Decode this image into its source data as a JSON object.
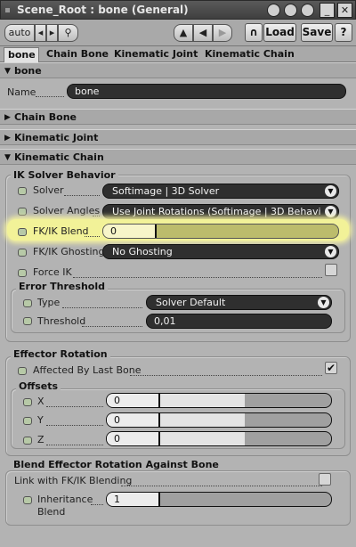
{
  "window": {
    "title": "Scene_Root : bone (General)"
  },
  "toolbar": {
    "auto_label": "auto",
    "prev_label": "◂",
    "next_label": "▸",
    "load_label": "Load",
    "save_label": "Save",
    "help_label": "?"
  },
  "tabs": [
    "bone",
    "Chain Bone",
    "Kinematic Joint",
    "Kinematic Chain"
  ],
  "sections": {
    "bone": {
      "title": "bone",
      "name_label": "Name",
      "name_value": "bone"
    },
    "chain_bone": {
      "title": "Chain Bone"
    },
    "kinematic_joint": {
      "title": "Kinematic Joint"
    },
    "kinematic_chain": {
      "title": "Kinematic Chain"
    }
  },
  "ik_solver": {
    "title": "IK Solver Behavior",
    "solver_label": "Solver",
    "solver_value": "Softimage | 3D Solver",
    "angles_label": "Solver Angles",
    "angles_value": "Use Joint Rotations (Softimage | 3D Behavi",
    "blend_label": "FK/IK Blend",
    "blend_value": "0",
    "blend_level": 0,
    "ghosting_label": "FK/IK Ghosting",
    "ghosting_value": "No Ghosting",
    "force_ik_label": "Force IK",
    "force_ik_checked": false
  },
  "error_threshold": {
    "title": "Error Threshold",
    "type_label": "Type",
    "type_value": "Solver Default",
    "threshold_label": "Threshold",
    "threshold_value": "0,01"
  },
  "effector_rotation": {
    "title": "Effector Rotation",
    "affected_label": "Affected By Last Bone",
    "affected_checked": true,
    "offsets_title": "Offsets",
    "x_label": "X",
    "x_value": "0",
    "x_level": 0.5,
    "y_label": "Y",
    "y_value": "0",
    "y_level": 0.5,
    "z_label": "Z",
    "z_value": "0",
    "z_level": 0.5
  },
  "blend_effector": {
    "title": "Blend Effector Rotation Against Bone",
    "link_label": "Link with FK/IK Blending",
    "link_checked": false,
    "inheritance_label_1": "Inheritance",
    "inheritance_label_2": "Blend",
    "inheritance_value": "1",
    "inheritance_level": 0
  }
}
